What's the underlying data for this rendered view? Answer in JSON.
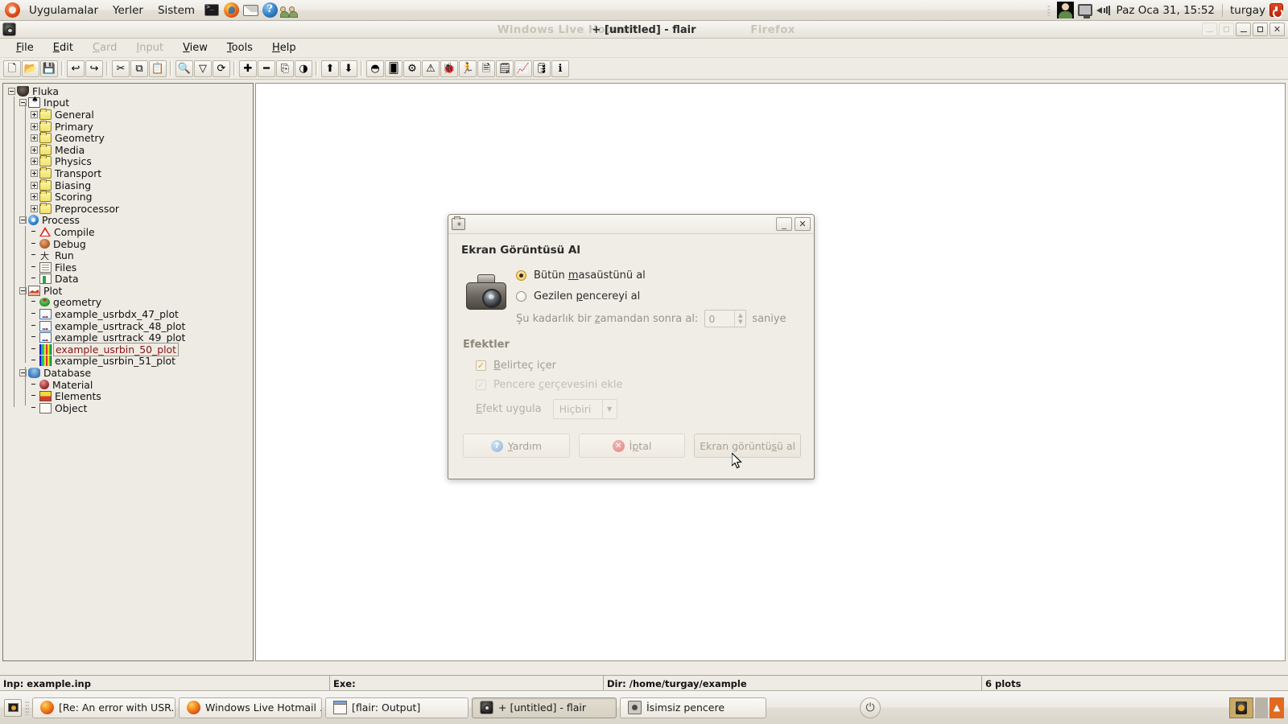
{
  "panel": {
    "menus": [
      "Uygulamalar",
      "Yerler",
      "Sistem"
    ],
    "launchers": [
      "terminal-icon",
      "firefox-icon",
      "mail-icon",
      "help-icon",
      "users-icon"
    ],
    "clock": "Paz Oca 31, 15:52",
    "user": "turgay",
    "tray": [
      "avatar-icon",
      "display-icon",
      "volume-icon"
    ]
  },
  "window": {
    "icon": "flair-icon",
    "title": "+ [untitled] - flair",
    "ghost_title_left": "Windows Live Hotmail",
    "ghost_title_right": "Firefox",
    "buttons": {
      "ghost_minimize": "_",
      "ghost_maximize": "▫",
      "minimize": "_",
      "maximize": "▫",
      "close": "✕"
    }
  },
  "menubar": [
    {
      "label": "File",
      "accel": "F",
      "disabled": false
    },
    {
      "label": "Edit",
      "accel": "E",
      "disabled": false
    },
    {
      "label": "Card",
      "accel": "C",
      "disabled": true
    },
    {
      "label": "Input",
      "accel": "I",
      "disabled": true
    },
    {
      "label": "View",
      "accel": "V",
      "disabled": false
    },
    {
      "label": "Tools",
      "accel": "T",
      "disabled": false
    },
    {
      "label": "Help",
      "accel": "H",
      "disabled": false
    }
  ],
  "toolbar": [
    {
      "name": "new-file-button",
      "glyph": "🗋"
    },
    {
      "name": "open-folder-button",
      "glyph": "📂"
    },
    {
      "name": "save-button",
      "glyph": "💾"
    },
    {
      "name": "separator-1",
      "glyph": ""
    },
    {
      "name": "undo-button",
      "glyph": "↩"
    },
    {
      "name": "redo-button",
      "glyph": "↪"
    },
    {
      "name": "separator-2",
      "glyph": ""
    },
    {
      "name": "cut-button",
      "glyph": "✂"
    },
    {
      "name": "copy-button",
      "glyph": "⧉"
    },
    {
      "name": "paste-button",
      "glyph": "📋"
    },
    {
      "name": "separator-3",
      "glyph": ""
    },
    {
      "name": "search-button",
      "glyph": "🔍"
    },
    {
      "name": "filter-button",
      "glyph": "▽"
    },
    {
      "name": "refresh-button",
      "glyph": "⟳"
    },
    {
      "name": "separator-4",
      "glyph": ""
    },
    {
      "name": "add-button",
      "glyph": "✚"
    },
    {
      "name": "remove-button",
      "glyph": "━"
    },
    {
      "name": "clone-button",
      "glyph": "⎘"
    },
    {
      "name": "palette-button",
      "glyph": "◑"
    },
    {
      "name": "separator-5",
      "glyph": ""
    },
    {
      "name": "move-up-button",
      "glyph": "⬆"
    },
    {
      "name": "move-down-button",
      "glyph": "⬇"
    },
    {
      "name": "separator-6",
      "glyph": ""
    },
    {
      "name": "fluka-pot-button",
      "glyph": "◓"
    },
    {
      "name": "input-cards-button",
      "glyph": "🂠"
    },
    {
      "name": "process-gear-button",
      "glyph": "⚙"
    },
    {
      "name": "compile-warn-button",
      "glyph": "⚠"
    },
    {
      "name": "debug-bug-button",
      "glyph": "🐞"
    },
    {
      "name": "run-button",
      "glyph": "🏃"
    },
    {
      "name": "files-button",
      "glyph": "🗎"
    },
    {
      "name": "data-button",
      "glyph": "🗒"
    },
    {
      "name": "plot-button",
      "glyph": "📈"
    },
    {
      "name": "database-button",
      "glyph": "🛢"
    },
    {
      "name": "info-button",
      "glyph": "ℹ"
    }
  ],
  "tree": [
    {
      "label": "Fluka",
      "level": 0,
      "expander": "minus",
      "icon": "ic-pot",
      "selected": false
    },
    {
      "label": "Input",
      "level": 1,
      "expander": "minus",
      "icon": "ic-cards",
      "selected": false
    },
    {
      "label": "General",
      "level": 2,
      "expander": "plus",
      "icon": "ic-folder",
      "selected": false
    },
    {
      "label": "Primary",
      "level": 2,
      "expander": "plus",
      "icon": "ic-folder",
      "selected": false
    },
    {
      "label": "Geometry",
      "level": 2,
      "expander": "plus",
      "icon": "ic-folder",
      "selected": false
    },
    {
      "label": "Media",
      "level": 2,
      "expander": "plus",
      "icon": "ic-folder",
      "selected": false
    },
    {
      "label": "Physics",
      "level": 2,
      "expander": "plus",
      "icon": "ic-folder",
      "selected": false
    },
    {
      "label": "Transport",
      "level": 2,
      "expander": "plus",
      "icon": "ic-folder",
      "selected": false
    },
    {
      "label": "Biasing",
      "level": 2,
      "expander": "plus",
      "icon": "ic-folder",
      "selected": false
    },
    {
      "label": "Scoring",
      "level": 2,
      "expander": "plus",
      "icon": "ic-folder",
      "selected": false
    },
    {
      "label": "Preprocessor",
      "level": 2,
      "expander": "plus",
      "icon": "ic-folder",
      "selected": false
    },
    {
      "label": "Process",
      "level": 1,
      "expander": "minus",
      "icon": "ic-gear",
      "selected": false
    },
    {
      "label": "Compile",
      "level": 2,
      "expander": "none",
      "icon": "ic-warn",
      "selected": false
    },
    {
      "label": "Debug",
      "level": 2,
      "expander": "none",
      "icon": "ic-bug",
      "selected": false
    },
    {
      "label": "Run",
      "level": 2,
      "expander": "none",
      "icon": "ic-run",
      "selected": false
    },
    {
      "label": "Files",
      "level": 2,
      "expander": "none",
      "icon": "ic-doc",
      "selected": false
    },
    {
      "label": "Data",
      "level": 2,
      "expander": "none",
      "icon": "ic-data",
      "selected": false
    },
    {
      "label": "Plot",
      "level": 1,
      "expander": "minus",
      "icon": "ic-plot",
      "selected": false
    },
    {
      "label": "geometry",
      "level": 2,
      "expander": "none",
      "icon": "ic-geo",
      "selected": false
    },
    {
      "label": "example_usrbdx_47_plot",
      "level": 2,
      "expander": "none",
      "icon": "ic-curve",
      "selected": false
    },
    {
      "label": "example_usrtrack_48_plot",
      "level": 2,
      "expander": "none",
      "icon": "ic-curve",
      "selected": false
    },
    {
      "label": "example_usrtrack_49_plot",
      "level": 2,
      "expander": "none",
      "icon": "ic-curve",
      "selected": false
    },
    {
      "label": "example_usrbin_50_plot",
      "level": 2,
      "expander": "none",
      "icon": "ic-usrbin",
      "selected": true
    },
    {
      "label": "example_usrbin_51_plot",
      "level": 2,
      "expander": "none",
      "icon": "ic-usrbin",
      "selected": false
    },
    {
      "label": "Database",
      "level": 1,
      "expander": "minus",
      "icon": "ic-db",
      "selected": false
    },
    {
      "label": "Material",
      "level": 2,
      "expander": "none",
      "icon": "ic-mat",
      "selected": false
    },
    {
      "label": "Elements",
      "level": 2,
      "expander": "none",
      "icon": "ic-elem",
      "selected": false
    },
    {
      "label": "Object",
      "level": 2,
      "expander": "none",
      "icon": "ic-obj",
      "selected": false
    }
  ],
  "statusbar": {
    "inp": "Inp: example.inp",
    "exe": "Exe:",
    "dir": "Dir: /home/turgay/example",
    "plots": "6 plots"
  },
  "taskbar": {
    "show_desktop": "show-desktop-icon",
    "tasks": [
      {
        "label": "[Re: An error with USR...",
        "icon": "ff",
        "active": false
      },
      {
        "label": "Windows Live Hotmail ...",
        "icon": "ff",
        "active": false
      },
      {
        "label": "[flair: Output]",
        "icon": "win",
        "active": false
      },
      {
        "label": "+ [untitled] - flair",
        "icon": "flair",
        "active": true
      },
      {
        "label": "İsimsiz pencere",
        "icon": "cam",
        "active": false
      }
    ],
    "power_glyph": "⏻"
  },
  "dialog": {
    "titlebar_icon": "camera-icon",
    "minimize": "_",
    "close": "✕",
    "heading": "Ekran Görüntüsü Al",
    "option_desktop": {
      "label_pre": "Bütün ",
      "accel": "m",
      "label_post": "asaüstünü al",
      "selected": true
    },
    "option_window": {
      "label_pre": "Gezilen ",
      "accel": "p",
      "label_post": "encereyi al",
      "selected": false
    },
    "delay": {
      "label_pre": "Şu kadarlık bir ",
      "accel": "z",
      "label_post": "amandan sonra al:",
      "value": "0",
      "placeholder": "0",
      "unit": "saniye"
    },
    "effects_title": "Efektler",
    "include_pointer": {
      "label_pre": "",
      "accel": "B",
      "label_post": "elirteç içer",
      "checked": true
    },
    "include_border": {
      "label_pre": "Pencere ",
      "accel": "ç",
      "label_post": "erçevesini ekle",
      "checked": true
    },
    "effect_label": {
      "label_pre": "",
      "accel": "E",
      "label_post": "fekt uygula"
    },
    "effect_value": "Hiçbiri",
    "buttons": {
      "help": {
        "label_pre": "",
        "accel": "Y",
        "label_post": "ardım"
      },
      "cancel": {
        "label_pre": "İ",
        "accel": "p",
        "label_post": "tal"
      },
      "take": {
        "label_pre": "Ekran görüntü",
        "accel": "s",
        "label_post": "ü al"
      }
    }
  }
}
